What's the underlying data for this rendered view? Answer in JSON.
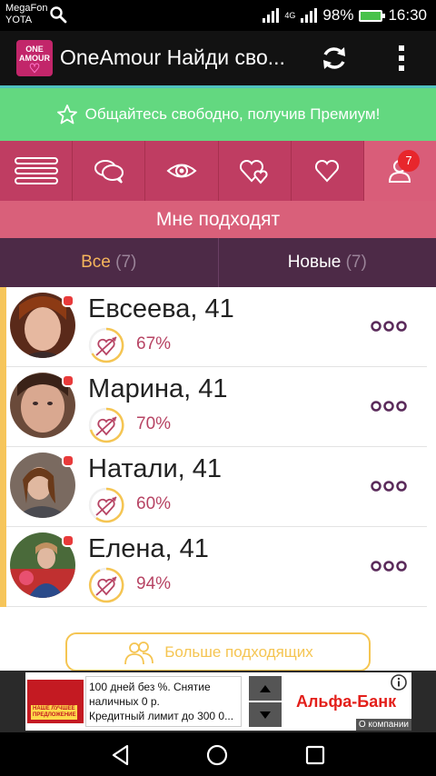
{
  "status_bar": {
    "carrier_1": "MegaFon",
    "carrier_2": "YOTA",
    "network": "4G",
    "battery": "98%",
    "time": "16:30"
  },
  "app_bar": {
    "logo_line_1": "ONE",
    "logo_line_2": "AMOUR",
    "title": "OneAmour Найди сво..."
  },
  "premium_banner": {
    "text": "Общайтесь свободно, получив Премиум!"
  },
  "nav": {
    "items": [
      "menu-icon",
      "chat-icon",
      "eye-icon",
      "hearts-icon",
      "heart-icon",
      "profile-icon"
    ],
    "badge": "7"
  },
  "section_title": "Мне подходят",
  "subtabs": [
    {
      "label": "Все",
      "count": "(7)"
    },
    {
      "label": "Новые",
      "count": "(7)"
    }
  ],
  "people": [
    {
      "name": "Евсеева, 41",
      "match": "67%"
    },
    {
      "name": "Марина, 41",
      "match": "70%"
    },
    {
      "name": "Натали, 41",
      "match": "60%"
    },
    {
      "name": "Елена, 41",
      "match": "94%"
    }
  ],
  "more_button": "Больше подходящих",
  "ad": {
    "line_1": "100 дней без %. Снятие",
    "line_2": "наличных 0 р.",
    "line_3": "Кредитный лимит до 300 0...",
    "image_tag_1": "НАШЕ ЛУЧШЕЕ",
    "image_tag_2": "ПРЕДЛОЖЕНИЕ",
    "bank": "Альфа-Банк",
    "company": "О компании"
  },
  "colors": {
    "nav_bg": "#bf3d62",
    "premium_bg": "#63d880",
    "subtab_bg": "#4d2a47",
    "accent": "#f5c552"
  }
}
